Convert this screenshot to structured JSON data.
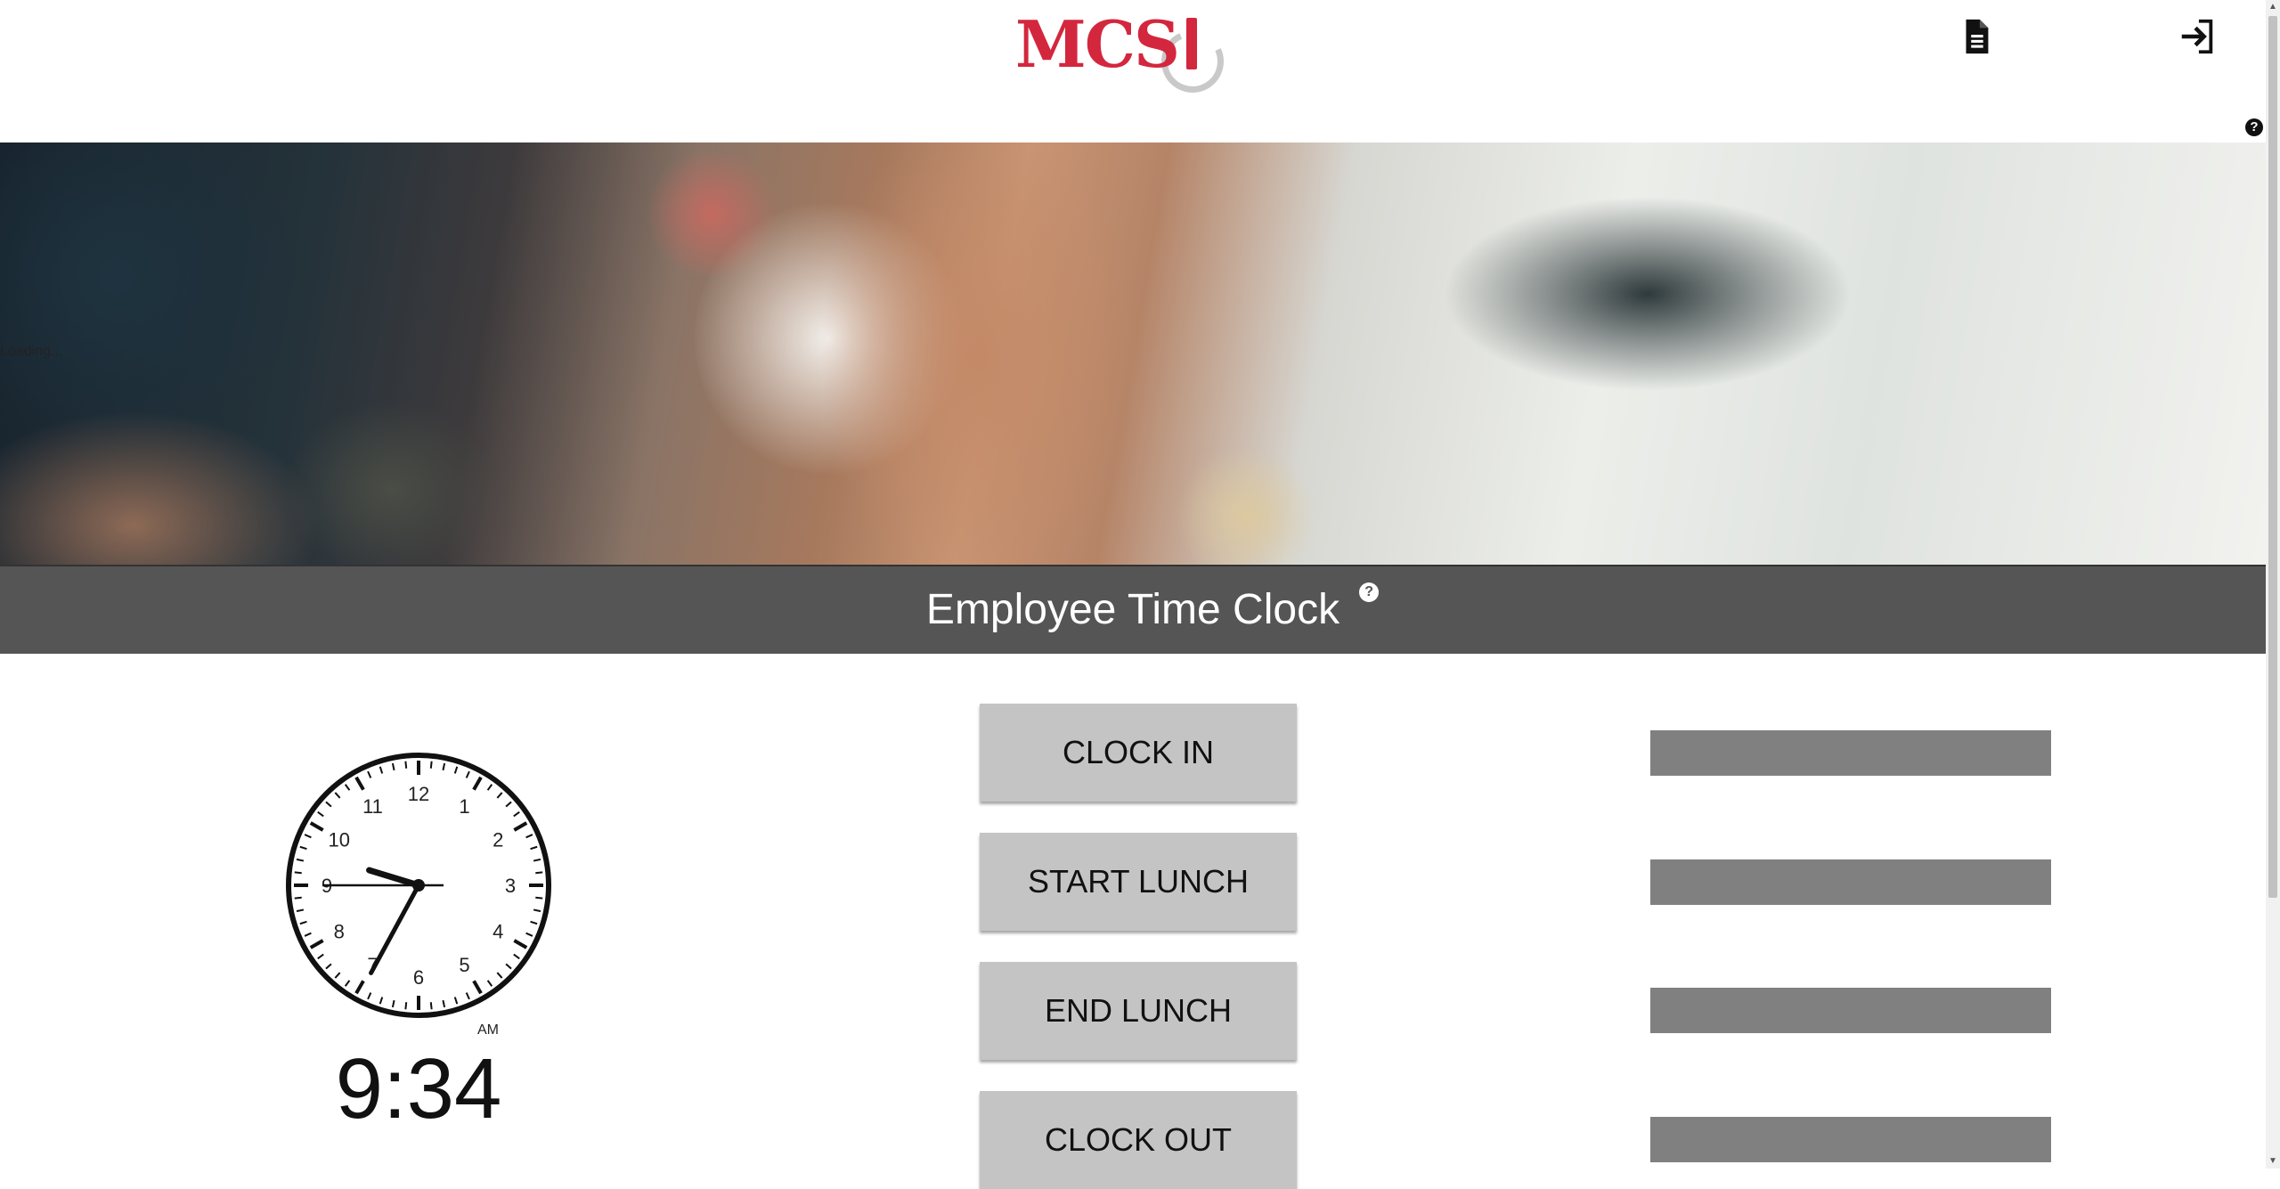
{
  "header": {
    "logo_text": "MCS",
    "report_icon": "document-icon",
    "logout_icon": "sign-in-icon",
    "help_glyph": "?"
  },
  "hero": {
    "loading_text": "Loading..."
  },
  "title_band": {
    "title": "Employee Time Clock",
    "help_glyph": "?"
  },
  "clock": {
    "numerals": [
      "12",
      "1",
      "2",
      "3",
      "4",
      "5",
      "6",
      "7",
      "8",
      "9",
      "10",
      "11"
    ],
    "ampm": "AM",
    "digital_time": "9:34",
    "hour": 9,
    "minute": 34,
    "second": 45
  },
  "actions": {
    "clock_in": "CLOCK IN",
    "start_lunch": "START LUNCH",
    "end_lunch": "END LUNCH",
    "clock_out": "CLOCK OUT"
  },
  "colors": {
    "brand_red": "#d3273e",
    "band_gray": "#555555",
    "button_gray": "#c4c4c4",
    "status_gray": "#808080"
  }
}
